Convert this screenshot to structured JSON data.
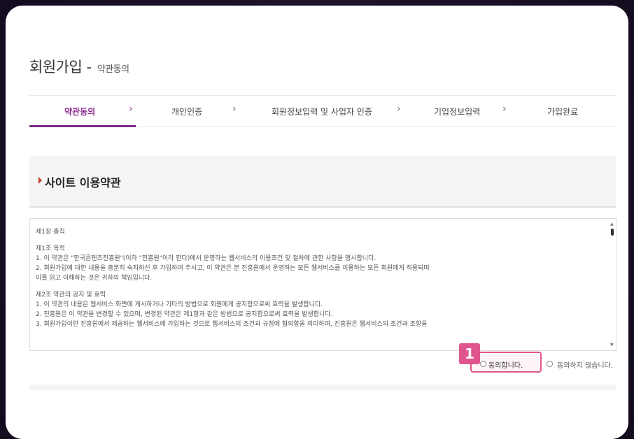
{
  "page": {
    "title": "회원가입 -",
    "subtitle": "약관동의"
  },
  "steps": [
    {
      "label": "약관동의",
      "active": true
    },
    {
      "label": "개인인증",
      "active": false
    },
    {
      "label": "회원정보입력 및 사업자 인증",
      "active": false
    },
    {
      "label": "기업정보입력",
      "active": false
    },
    {
      "label": "가입완료",
      "active": false
    }
  ],
  "step_separator": "›",
  "section": {
    "title": "사이트 이용약관"
  },
  "terms": {
    "lines": [
      "제1장 총칙",
      "",
      "제1조 목적",
      "1. 이 약관은 \"한국콘텐츠진흥원\"(이하 \"진흥원\"이라 한다)에서 운영하는 웹서비스의 이용조건 및 절차에 관한 사항을 명시합니다.",
      "2. 회원가입에 대한 내용을 충분히 숙지하신 후 가입하여 주시고, 이 약관은 본 진흥원에서 운영하는 모든 웹서비스를 이용하는 모든 회원에게 적용되며",
      " 이를 읽고 이해하는 것은 귀하의 책임입니다.",
      "",
      "제2조 약관의 공지 및 효력",
      "1. 이 약관의 내용은 웹서비스 화면에 게시하거나 기타의 방법으로 회원에게 공지함으로써 효력을 발생합니다.",
      "2. 진흥원은 이 약관을 변경할 수 있으며, 변경된 약관은 제1항과 같은 방법으로 공지함으로써 효력을 발생합니다.",
      "3. 회원가입이란 진흥원에서 제공하는 웹서비스에 가입하는 것으로 웹서비스의 조건과 규정에 협의함을 의미하며, 진흥원은 웹서비스의 조건과 조항을"
    ]
  },
  "agreement": {
    "agree_label": "동의합니다.",
    "disagree_label": "동의하지 않습니다.",
    "badge": "1"
  },
  "colors": {
    "accent": "#8b2a8e",
    "highlight": "#e0558d"
  }
}
